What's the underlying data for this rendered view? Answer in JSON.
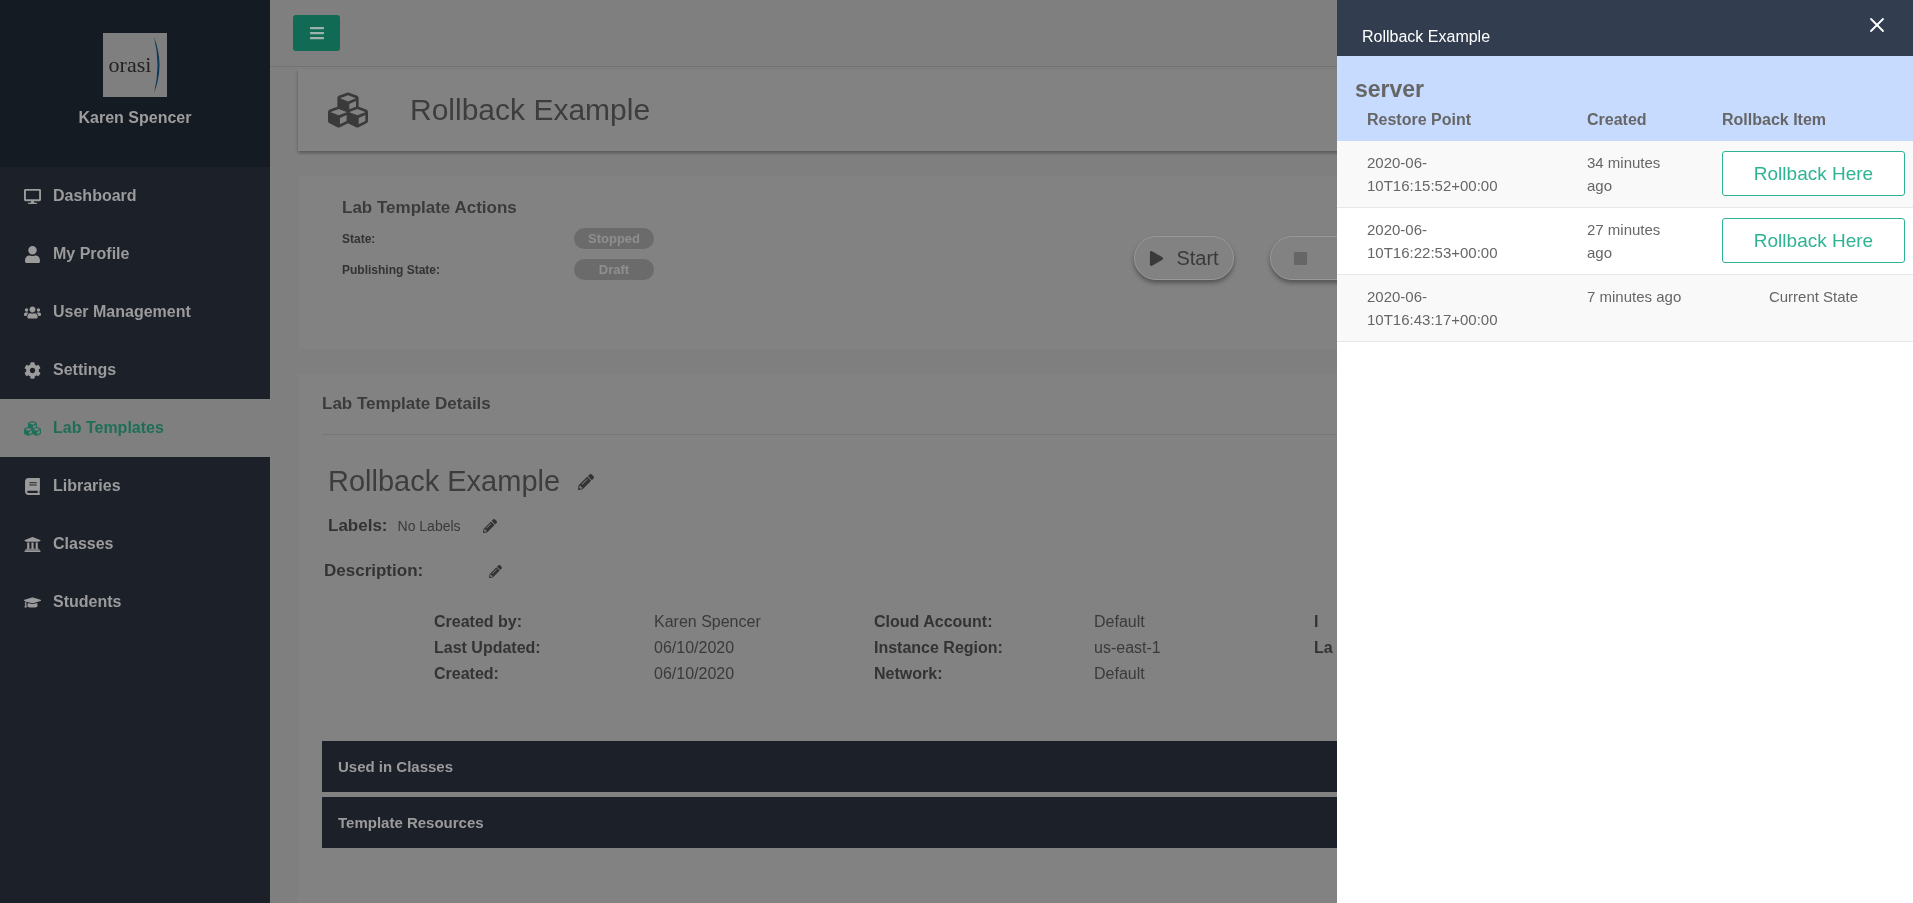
{
  "sidebar": {
    "logo": "orasi",
    "user": "Karen Spencer",
    "items": [
      {
        "label": "Dashboard",
        "selected": false
      },
      {
        "label": "My Profile",
        "selected": false
      },
      {
        "label": "User Management",
        "selected": false
      },
      {
        "label": "Settings",
        "selected": false
      },
      {
        "label": "Lab Templates",
        "selected": true
      },
      {
        "label": "Libraries",
        "selected": false
      },
      {
        "label": "Classes",
        "selected": false
      },
      {
        "label": "Students",
        "selected": false
      }
    ]
  },
  "page_header": {
    "title": "Rollback Example"
  },
  "actions": {
    "title": "Lab Template Actions",
    "fields": [
      {
        "label": "State:",
        "value": "Stopped"
      },
      {
        "label": "Publishing State:",
        "value": "Draft"
      }
    ],
    "buttons": [
      {
        "kind": "start",
        "label": "Start"
      },
      {
        "kind": "stop"
      }
    ]
  },
  "details": {
    "title": "Lab Template Details",
    "name": "Rollback Example",
    "labels_label": "Labels:",
    "labels_value": "No Labels",
    "description_label": "Description:",
    "columns": [
      [
        {
          "label": "Created by:",
          "value": "Karen Spencer"
        },
        {
          "label": "Last Updated:",
          "value": "06/10/2020"
        },
        {
          "label": "Created:",
          "value": "06/10/2020"
        }
      ],
      [
        {
          "label": "Cloud Account:",
          "value": "Default"
        },
        {
          "label": "Instance Region:",
          "value": "us-east-1"
        },
        {
          "label": "Network:",
          "value": "Default"
        }
      ],
      [
        {
          "label": "I"
        },
        {
          "label": "La"
        }
      ]
    ]
  },
  "sections": [
    "Used in Classes",
    "Template Resources"
  ],
  "drawer": {
    "title": "Rollback Example",
    "group": "server",
    "columns": [
      "Restore Point",
      "Created",
      "Rollback Item"
    ],
    "rows": [
      {
        "restore_point": "2020-06-10T16:15:52+00:00",
        "created": "34 minutes ago",
        "action": {
          "kind": "button",
          "label": "Rollback Here"
        }
      },
      {
        "restore_point": "2020-06-10T16:22:53+00:00",
        "created": "27 minutes ago",
        "action": {
          "kind": "button",
          "label": "Rollback Here"
        }
      },
      {
        "restore_point": "2020-06-10T16:43:17+00:00",
        "created": "7 minutes ago",
        "action": {
          "kind": "text",
          "label": "Current State"
        }
      }
    ]
  }
}
